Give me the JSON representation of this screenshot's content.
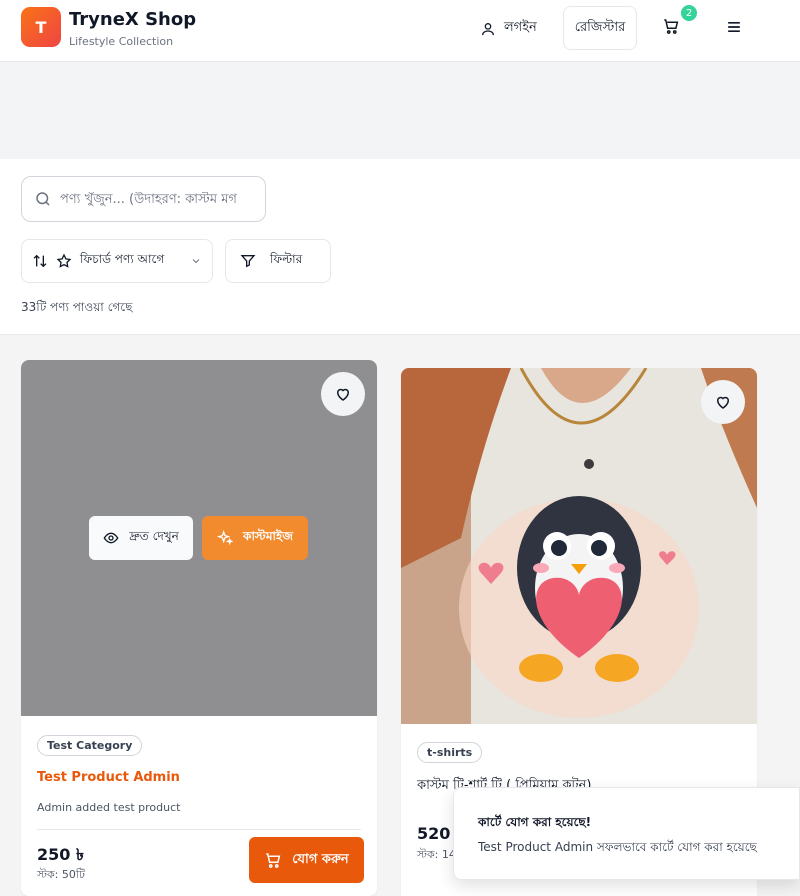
{
  "header": {
    "logo_letter": "T",
    "brand": "TryneX Shop",
    "tagline": "Lifestyle Collection",
    "login_label": "লগইন",
    "register_label": "রেজিস্টার",
    "cart_count": "2"
  },
  "toolbar": {
    "search_placeholder": "পণ্য খুঁজুন... (উদাহরণ: কাস্টম মগ",
    "sort_label": "ফিচার্ড পণ্য আগে",
    "filter_label": "ফিল্টার",
    "result_count": "33টি পণ্য পাওয়া গেছে"
  },
  "products": [
    {
      "category": "Test Category",
      "title": "Test Product Admin",
      "description": "Admin added test product",
      "price": "250 ৳",
      "stock": "স্টক: 50টি",
      "quick_view_label": "দ্রুত দেখুন",
      "customize_label": "কাস্টমাইজ",
      "add_label": "যোগ করুন"
    },
    {
      "category": "t-shirts",
      "title": "কাস্টম টি-শার্ট টি ( প্রিমিয়াম কটন)",
      "price": "520 ৳",
      "stock": "স্টক: 14টি"
    }
  ],
  "toast": {
    "title": "কার্টে যোগ করা হয়েছে!",
    "message": "Test Product Admin সফলভাবে কার্টে যোগ করা হয়েছে"
  },
  "colors": {
    "accent": "#e8590c",
    "badge": "#34d399"
  }
}
